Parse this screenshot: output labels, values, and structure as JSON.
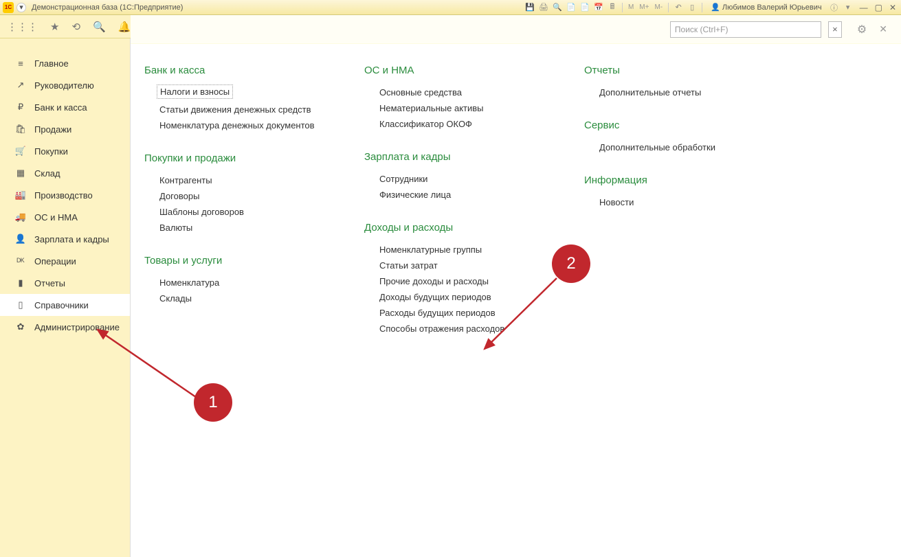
{
  "titlebar": {
    "title": "Демонстрационная база  (1С:Предприятие)",
    "m1": "M",
    "m2": "M+",
    "m3": "M-",
    "user": "Любимов Валерий Юрьевич"
  },
  "sidebar": {
    "items": [
      {
        "icon": "≡",
        "label": "Главное"
      },
      {
        "icon": "↗",
        "label": "Руководителю"
      },
      {
        "icon": "₽",
        "label": "Банк и касса"
      },
      {
        "icon": "🛍",
        "label": "Продажи"
      },
      {
        "icon": "🛒",
        "label": "Покупки"
      },
      {
        "icon": "▦",
        "label": "Склад"
      },
      {
        "icon": "🏭",
        "label": "Производство"
      },
      {
        "icon": "🚚",
        "label": "ОС и НМА"
      },
      {
        "icon": "👤",
        "label": "Зарплата и кадры"
      },
      {
        "icon": "ᴰᴷ",
        "label": "Операции"
      },
      {
        "icon": "▮",
        "label": "Отчеты"
      },
      {
        "icon": "▯",
        "label": "Справочники"
      },
      {
        "icon": "✿",
        "label": "Администрирование"
      }
    ]
  },
  "search": {
    "placeholder": "Поиск (Ctrl+F)"
  },
  "col1": {
    "s1": {
      "title": "Банк и касса",
      "links": [
        "Налоги и взносы",
        "Статьи движения денежных средств",
        "Номенклатура денежных документов"
      ]
    },
    "s2": {
      "title": "Покупки и продажи",
      "links": [
        "Контрагенты",
        "Договоры",
        "Шаблоны договоров",
        "Валюты"
      ]
    },
    "s3": {
      "title": "Товары и услуги",
      "links": [
        "Номенклатура",
        "Склады"
      ]
    }
  },
  "col2": {
    "s1": {
      "title": "ОС и НМА",
      "links": [
        "Основные средства",
        "Нематериальные активы",
        "Классификатор ОКОФ"
      ]
    },
    "s2": {
      "title": "Зарплата и кадры",
      "links": [
        "Сотрудники",
        "Физические лица"
      ]
    },
    "s3": {
      "title": "Доходы и расходы",
      "links": [
        "Номенклатурные группы",
        "Статьи затрат",
        "Прочие доходы и расходы",
        "Доходы будущих периодов",
        "Расходы будущих периодов",
        "Способы отражения расходов"
      ]
    }
  },
  "col3": {
    "s1": {
      "title": "Отчеты",
      "links": [
        "Дополнительные отчеты"
      ]
    },
    "s2": {
      "title": "Сервис",
      "links": [
        "Дополнительные обработки"
      ]
    },
    "s3": {
      "title": "Информация",
      "links": [
        "Новости"
      ]
    }
  },
  "badges": {
    "b1": "1",
    "b2": "2"
  }
}
